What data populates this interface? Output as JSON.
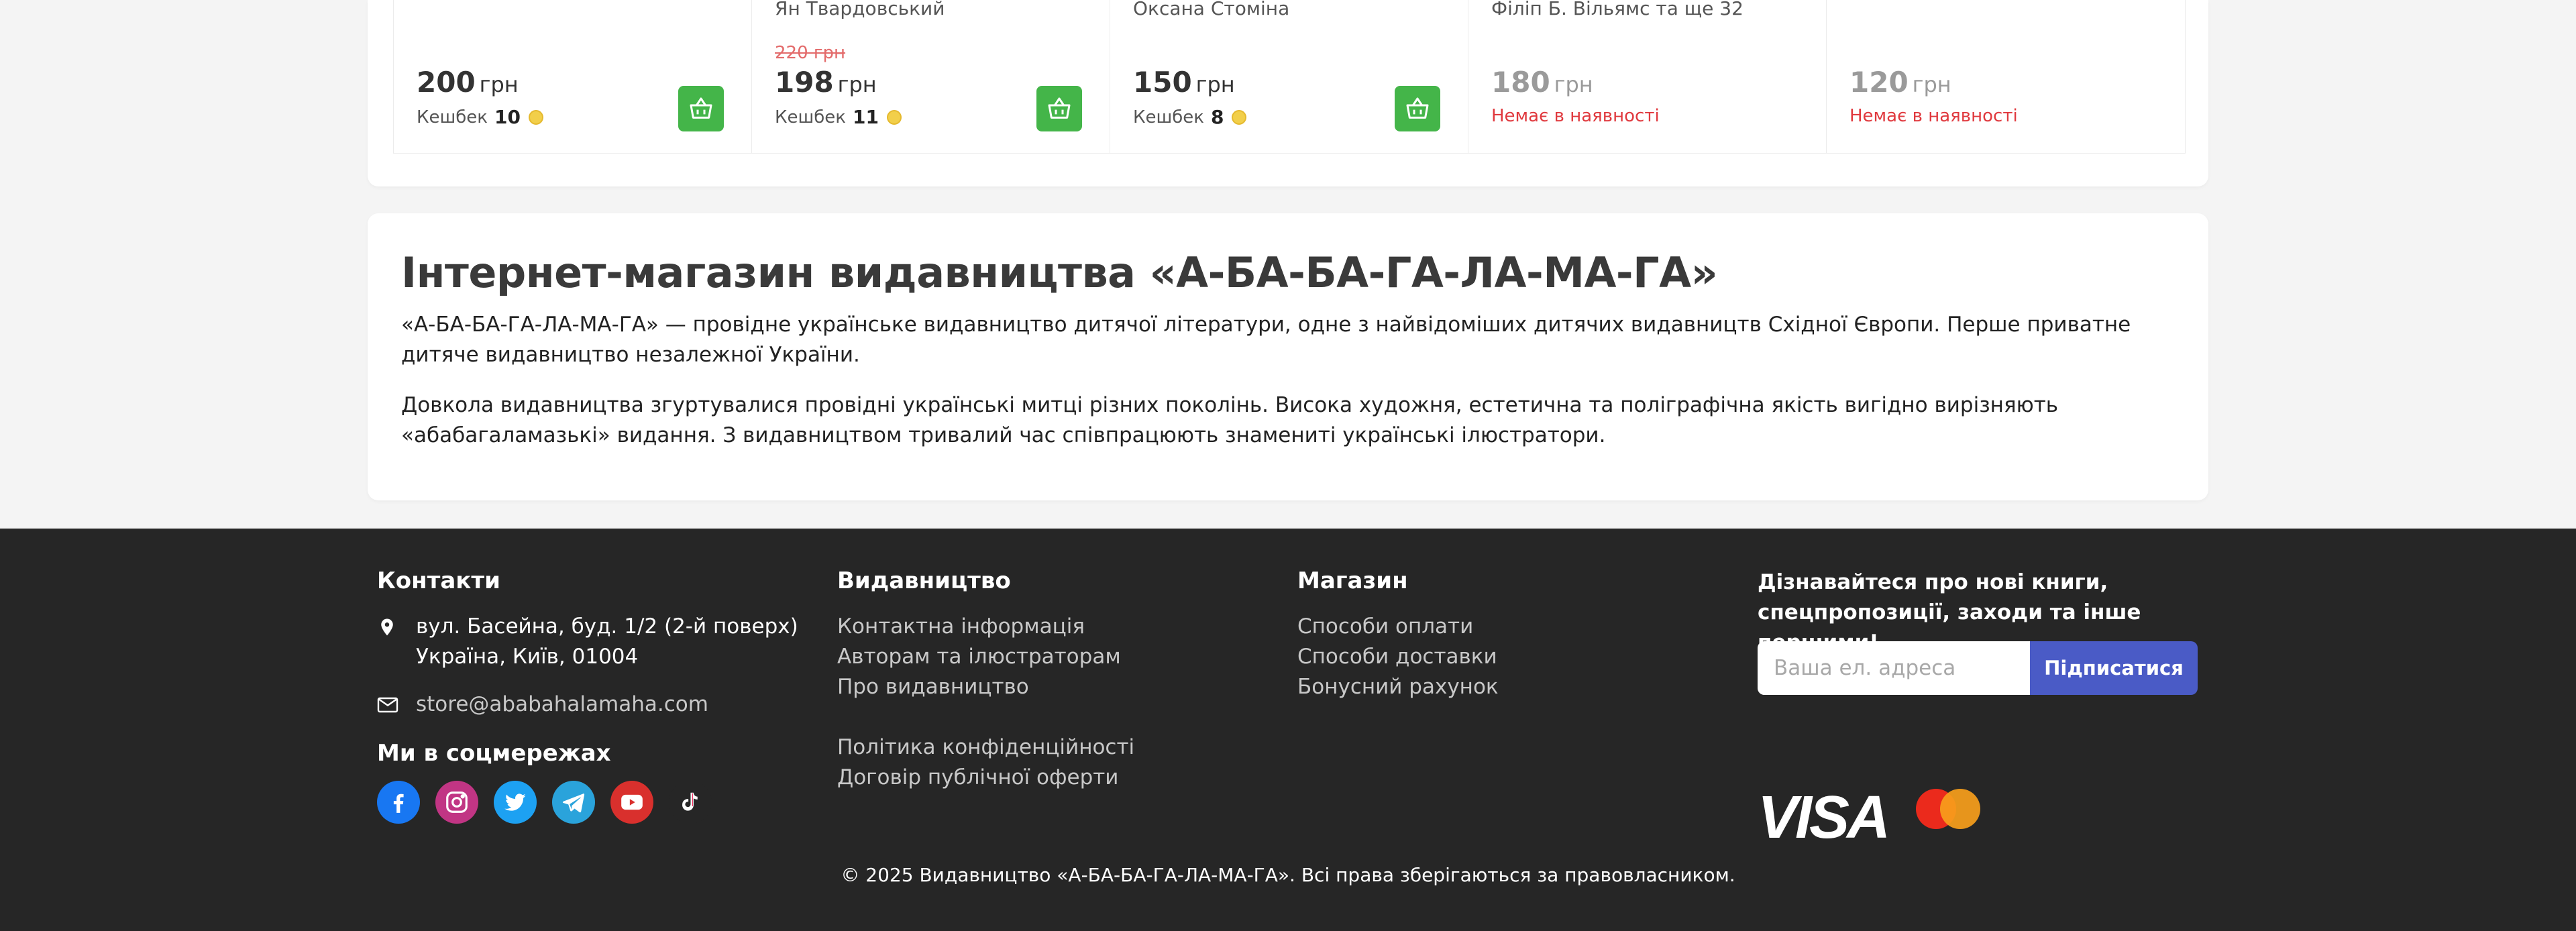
{
  "products": [
    {
      "author": "",
      "old_price": "",
      "price": "200",
      "currency": "грн",
      "cashback_label": "Кешбек",
      "cashback": "10",
      "in_stock": true
    },
    {
      "author": "Ян Твардовський",
      "old_price": "220 грн",
      "price": "198",
      "currency": "грн",
      "cashback_label": "Кешбек",
      "cashback": "11",
      "in_stock": true
    },
    {
      "author": "Оксана Стоміна",
      "old_price": "",
      "price": "150",
      "currency": "грн",
      "cashback_label": "Кешбек",
      "cashback": "8",
      "in_stock": true
    },
    {
      "author": "Філіп Б. Вільямс та ще 32",
      "old_price": "",
      "price": "180",
      "currency": "грн",
      "status": "Немає в наявності",
      "in_stock": false
    },
    {
      "author": "",
      "old_price": "",
      "price": "120",
      "currency": "грн",
      "status": "Немає в наявності",
      "in_stock": false
    }
  ],
  "about": {
    "title": "Інтернет-магазин видавництва «А-БА-БА-ГА-ЛА-МА-ГА»",
    "paragraph1": "«А-БА-БА-ГА-ЛА-МА-ГА» — провідне українське видавництво дитячої літератури, одне з найвідоміших дитячих видавництв Східної Європи. Перше приватне дитяче видавництво незалежної України.",
    "paragraph2": "Довкола видавництва згуртувалися провідні українські митці різних поколінь. Висока художня, естетична та поліграфічна якість вигідно вирізняють «абабагаламазькі» видання. З видавництвом тривалий час співпрацюють знамениті українські ілюстратори."
  },
  "footer": {
    "contacts": {
      "title": "Контакти",
      "address_line1": "вул. Басейна, буд. 1/2 (2-й поверх)",
      "address_line2": "Україна, Київ, 01004",
      "email": "store@ababahalamaha.com"
    },
    "social_title": "Ми в соцмережах",
    "socials": [
      "facebook-icon",
      "instagram-icon",
      "twitter-icon",
      "telegram-icon",
      "youtube-icon",
      "tiktok-icon"
    ],
    "publisher": {
      "title": "Видавництво",
      "links": [
        "Контактна інформація",
        "Авторам та ілюстраторам",
        "Про видавництво",
        "Політика конфіденційності",
        "Договір публічної оферти"
      ]
    },
    "shop": {
      "title": "Магазин",
      "links": [
        "Способи оплати",
        "Способи доставки",
        "Бонусний рахунок"
      ]
    },
    "subscribe": {
      "title": "Дізнавайтеся про нові книги, спецпропозиції, заходи та інше першими!",
      "placeholder": "Ваша ел. адреса",
      "button": "Підписатися"
    },
    "payment": {
      "visa": "VISA",
      "mastercard": "mastercard-logo"
    },
    "copyright": "© 2025 Видавництво «А-БА-БА-ГА-ЛА-МА-ГА». Всі права зберігаються за правовласником."
  },
  "colors": {
    "cart": "#44b549",
    "out_of_stock": "#e0393e",
    "subscribe": "#4a5bc6",
    "footer_bg": "#262626"
  }
}
